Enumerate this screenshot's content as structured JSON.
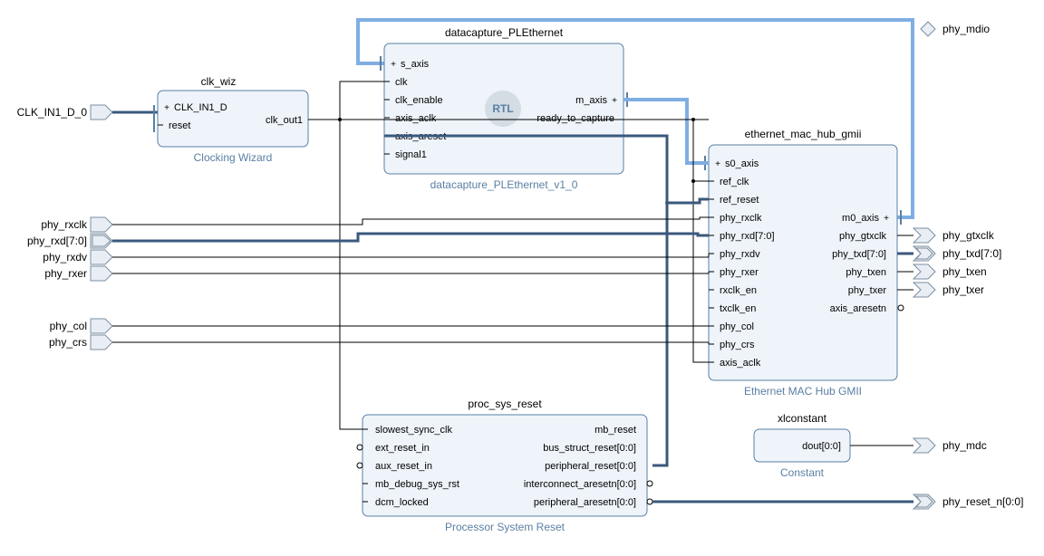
{
  "ext_in": {
    "clk_in": "CLK_IN1_D_0",
    "rxclk": "phy_rxclk",
    "rxd": "phy_rxd[7:0]",
    "rxdv": "phy_rxdv",
    "rxer": "phy_rxer",
    "col": "phy_col",
    "crs": "phy_crs"
  },
  "ext_out": {
    "mdio": "phy_mdio",
    "gtxclk": "phy_gtxclk",
    "txd": "phy_txd[7:0]",
    "txen": "phy_txen",
    "txer": "phy_txer",
    "mdc": "phy_mdc",
    "reset_n": "phy_reset_n[0:0]"
  },
  "clk_wiz": {
    "title": "clk_wiz",
    "subtitle": "Clocking Wizard",
    "ports_l": {
      "clk_in": "CLK_IN1_D",
      "reset": "reset"
    },
    "ports_r": {
      "clk_out": "clk_out1"
    }
  },
  "datacap": {
    "title": "datacapture_PLEthernet",
    "subtitle": "datacapture_PLEthernet_v1_0",
    "rtl": "RTL",
    "ports_l": {
      "s_axis": "s_axis",
      "clk": "clk",
      "clk_enable": "clk_enable",
      "axis_aclk": "axis_aclk",
      "axis_areset": "axis_areset",
      "signal1": "signal1"
    },
    "ports_r": {
      "m_axis": "m_axis",
      "ready": "ready_to_capture"
    }
  },
  "eth": {
    "title": "ethernet_mac_hub_gmii",
    "subtitle": "Ethernet MAC Hub GMII",
    "ports_l": {
      "s0_axis": "s0_axis",
      "ref_clk": "ref_clk",
      "ref_reset": "ref_reset",
      "rxclk": "phy_rxclk",
      "rxd": "phy_rxd[7:0]",
      "rxdv": "phy_rxdv",
      "rxer": "phy_rxer",
      "rxclk_en": "rxclk_en",
      "txclk_en": "txclk_en",
      "col": "phy_col",
      "crs": "phy_crs",
      "axis_aclk": "axis_aclk"
    },
    "ports_r": {
      "m0_axis": "m0_axis",
      "gtxclk": "phy_gtxclk",
      "txd": "phy_txd[7:0]",
      "txen": "phy_txen",
      "txer": "phy_txer",
      "aresetn": "axis_aresetn"
    }
  },
  "psr": {
    "title": "proc_sys_reset",
    "subtitle": "Processor System Reset",
    "ports_l": {
      "slow": "slowest_sync_clk",
      "ext": "ext_reset_in",
      "aux": "aux_reset_in",
      "mb": "mb_debug_sys_rst",
      "dcm": "dcm_locked"
    },
    "ports_r": {
      "mb_reset": "mb_reset",
      "bus": "bus_struct_reset[0:0]",
      "periph": "peripheral_reset[0:0]",
      "inter": "interconnect_aresetn[0:0]",
      "periphn": "peripheral_aresetn[0:0]"
    }
  },
  "xlc": {
    "title": "xlconstant",
    "subtitle": "Constant",
    "port": "dout[0:0]"
  }
}
